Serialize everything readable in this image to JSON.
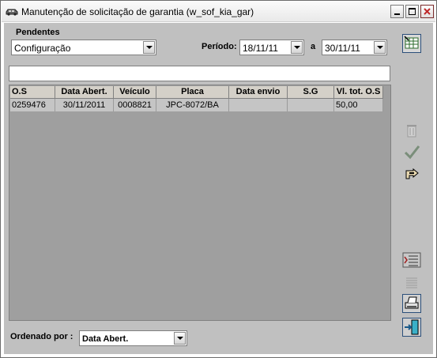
{
  "window": {
    "title": "Manutenção de solicitação de garantia (w_sof_kia_gar)"
  },
  "filters": {
    "pendentes_label": "Pendentes",
    "pendentes_value": "Configuração",
    "periodo_label": "Período:",
    "date_from": "18/11/11",
    "date_sep": "a",
    "date_to": "30/11/11"
  },
  "search": {
    "value": ""
  },
  "grid": {
    "columns": [
      "O.S",
      "Data Abert.",
      "Veículo",
      "Placa",
      "Data envio",
      "S.G",
      "Vl. tot. O.S"
    ],
    "rows": [
      [
        "0259476",
        "30/11/2011",
        "0008821",
        "JPC-8072/BA",
        "",
        "",
        "50,00"
      ]
    ]
  },
  "footer": {
    "order_label": "Ordenado por :",
    "order_value": "Data Abert."
  },
  "toolbar": {
    "icons": [
      "grid-select-icon",
      "trash-icon",
      "checkmark-icon",
      "pointing-hand-icon",
      "multi-list-icon",
      "list-icon",
      "printer-icon",
      "exit-door-icon"
    ]
  },
  "colors": {
    "background": "#c0c0c0",
    "selected_row": "#c5c5c5",
    "grid_empty": "#9f9f9f"
  }
}
